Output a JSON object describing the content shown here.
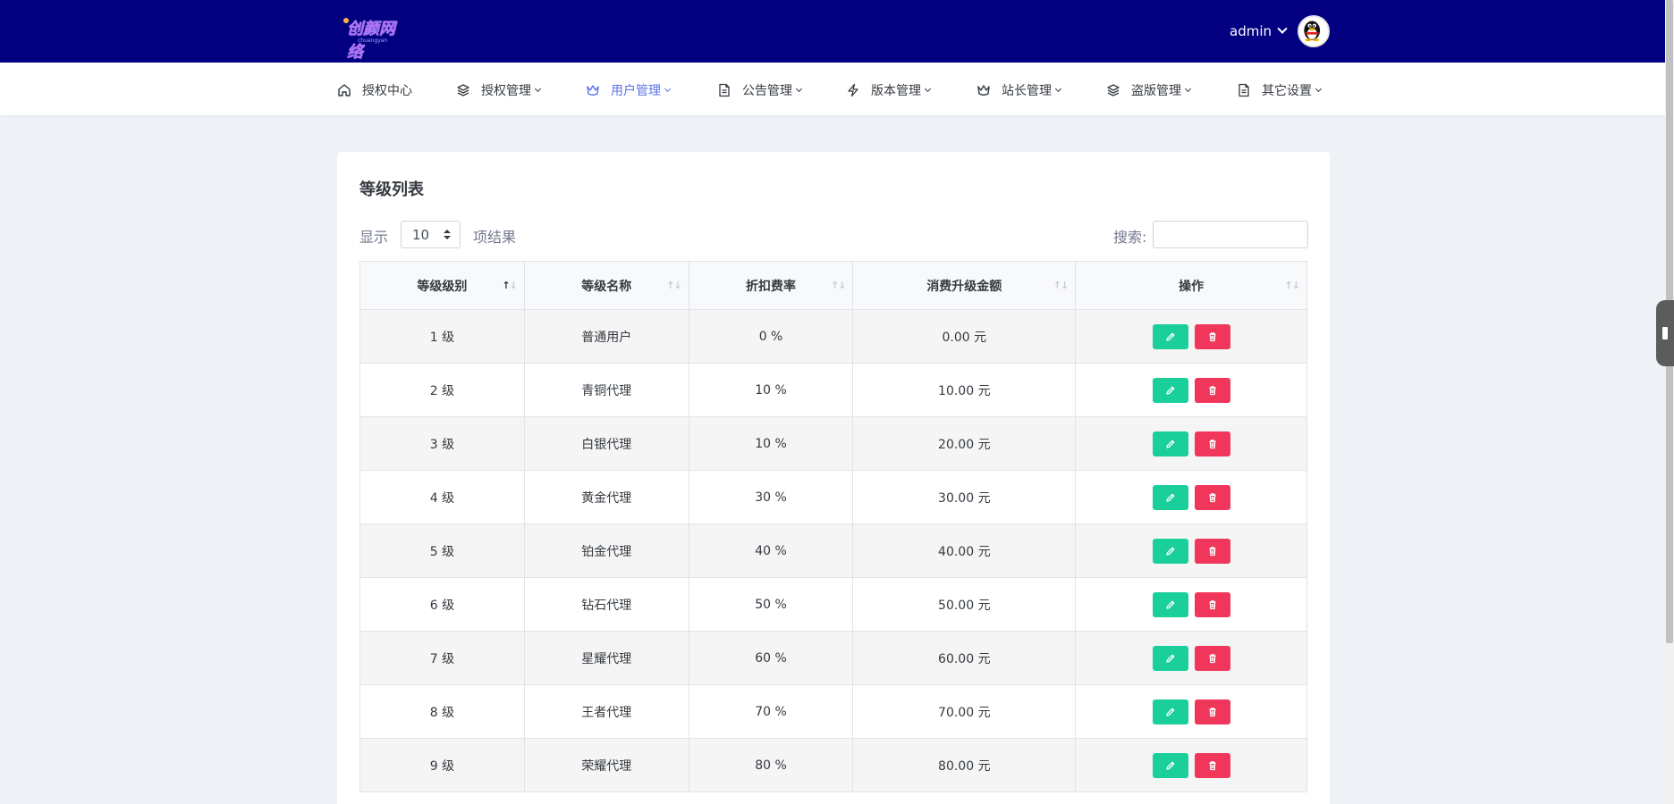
{
  "header": {
    "logo_text": "创颜网络",
    "logo_sub": "chuangyan",
    "username": "admin"
  },
  "nav": [
    {
      "label": "授权中心",
      "icon": "home-icon",
      "has_dropdown": false,
      "active": false
    },
    {
      "label": "授权管理",
      "icon": "layers-icon",
      "has_dropdown": true,
      "active": false
    },
    {
      "label": "用户管理",
      "icon": "crown-icon",
      "has_dropdown": true,
      "active": true
    },
    {
      "label": "公告管理",
      "icon": "document-icon",
      "has_dropdown": true,
      "active": false
    },
    {
      "label": "版本管理",
      "icon": "bolt-icon",
      "has_dropdown": true,
      "active": false
    },
    {
      "label": "站长管理",
      "icon": "crown-icon",
      "has_dropdown": true,
      "active": false
    },
    {
      "label": "盗版管理",
      "icon": "layers-icon",
      "has_dropdown": true,
      "active": false
    },
    {
      "label": "其它设置",
      "icon": "document-icon",
      "has_dropdown": true,
      "active": false
    }
  ],
  "card": {
    "title": "等级列表",
    "length_prefix": "显示",
    "length_value": "10",
    "length_suffix": "项结果",
    "search_label": "搜索:",
    "search_value": ""
  },
  "table": {
    "headers": [
      "等级级别",
      "等级名称",
      "折扣费率",
      "消费升级金额",
      "操作"
    ],
    "rows": [
      {
        "level": "1 级",
        "name": "普通用户",
        "rate": "0 %",
        "amount": "0.00 元"
      },
      {
        "level": "2 级",
        "name": "青铜代理",
        "rate": "10 %",
        "amount": "10.00 元"
      },
      {
        "level": "3 级",
        "name": "白银代理",
        "rate": "10 %",
        "amount": "20.00 元"
      },
      {
        "level": "4 级",
        "name": "黄金代理",
        "rate": "30 %",
        "amount": "30.00 元"
      },
      {
        "level": "5 级",
        "name": "铂金代理",
        "rate": "40 %",
        "amount": "40.00 元"
      },
      {
        "level": "6 级",
        "name": "钻石代理",
        "rate": "50 %",
        "amount": "50.00 元"
      },
      {
        "level": "7 级",
        "name": "星耀代理",
        "rate": "60 %",
        "amount": "60.00 元"
      },
      {
        "level": "8 级",
        "name": "王者代理",
        "rate": "70 %",
        "amount": "70.00 元"
      },
      {
        "level": "9 级",
        "name": "荣耀代理",
        "rate": "80 %",
        "amount": "80.00 元"
      }
    ]
  },
  "colors": {
    "topbar": "#020080",
    "active_nav": "#5b73e8",
    "edit_button": "#1bcf9a",
    "delete_button": "#f0365a"
  }
}
